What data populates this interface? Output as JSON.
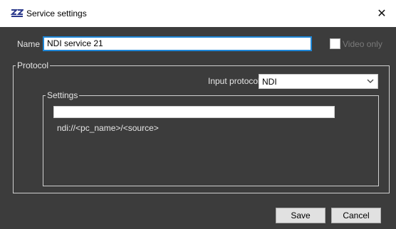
{
  "window": {
    "title": "Service settings",
    "close_glyph": "✕",
    "app_icon": "zz-logo-icon"
  },
  "form": {
    "name_label": "Name",
    "name_value": "NDI service 21",
    "video_only_label": "Video only",
    "video_only_checked": false
  },
  "protocol_group": {
    "legend": "Protocol",
    "input_protocol_label": "Input protocol",
    "input_protocol_value": "NDI"
  },
  "settings_group": {
    "legend": "Settings",
    "source_value": "",
    "hint": "ndi://<pc_name>/<source>"
  },
  "buttons": {
    "save_label": "Save",
    "cancel_label": "Cancel"
  },
  "colors": {
    "background": "#3c3c3c",
    "focus_border": "#1e86d6",
    "logo": "#2c3a8c"
  }
}
